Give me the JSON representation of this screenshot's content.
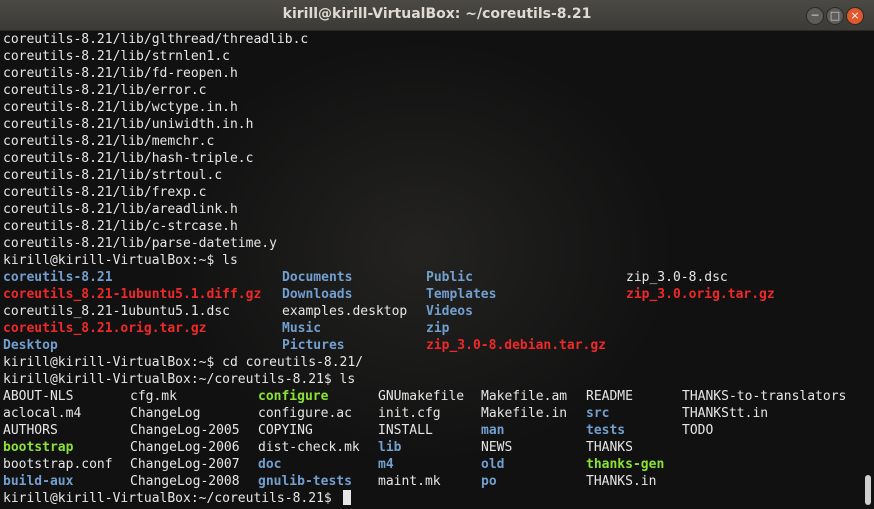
{
  "window": {
    "title": "kirill@kirill-VirtualBox: ~/coreutils-8.21",
    "buttons": {
      "minimize": "─",
      "maximize": "□",
      "close": "×"
    }
  },
  "colors": {
    "dir": "#729fcf",
    "archive": "#ef2929",
    "exec": "#8ae234",
    "text": "#e6e6e6"
  },
  "terminal": {
    "path_lines": [
      "coreutils-8.21/lib/glthread/threadlib.c",
      "coreutils-8.21/lib/strnlen1.c",
      "coreutils-8.21/lib/fd-reopen.h",
      "coreutils-8.21/lib/error.c",
      "coreutils-8.21/lib/wctype.in.h",
      "coreutils-8.21/lib/uniwidth.in.h",
      "coreutils-8.21/lib/memchr.c",
      "coreutils-8.21/lib/hash-triple.c",
      "coreutils-8.21/lib/strtoul.c",
      "coreutils-8.21/lib/frexp.c",
      "coreutils-8.21/lib/areadlink.h",
      "coreutils-8.21/lib/c-strcase.h",
      "coreutils-8.21/lib/parse-datetime.y"
    ],
    "prompt1": "kirill@kirill-VirtualBox:~$ ls",
    "ls1": [
      [
        {
          "t": "coreutils-8.21",
          "k": "dir"
        },
        {
          "t": "Documents",
          "k": "dir"
        },
        {
          "t": "Public",
          "k": "dir"
        },
        {
          "t": "zip_3.0-8.dsc",
          "k": "plain"
        }
      ],
      [
        {
          "t": "coreutils_8.21-1ubuntu5.1.diff.gz",
          "k": "arc"
        },
        {
          "t": "Downloads",
          "k": "dir"
        },
        {
          "t": "Templates",
          "k": "dir"
        },
        {
          "t": "zip_3.0.orig.tar.gz",
          "k": "arc"
        }
      ],
      [
        {
          "t": "coreutils_8.21-1ubuntu5.1.dsc",
          "k": "plain"
        },
        {
          "t": "examples.desktop",
          "k": "plain"
        },
        {
          "t": "Videos",
          "k": "dir"
        },
        {
          "t": "",
          "k": "plain"
        }
      ],
      [
        {
          "t": "coreutils_8.21.orig.tar.gz",
          "k": "arc"
        },
        {
          "t": "Music",
          "k": "dir"
        },
        {
          "t": "zip",
          "k": "dir"
        },
        {
          "t": "",
          "k": "plain"
        }
      ],
      [
        {
          "t": "Desktop",
          "k": "dir"
        },
        {
          "t": "Pictures",
          "k": "dir"
        },
        {
          "t": "zip_3.0-8.debian.tar.gz",
          "k": "arc"
        },
        {
          "t": "",
          "k": "plain"
        }
      ]
    ],
    "prompt2": "kirill@kirill-VirtualBox:~$ cd coreutils-8.21/",
    "prompt3": "kirill@kirill-VirtualBox:~/coreutils-8.21$ ls",
    "ls2": [
      [
        {
          "t": "ABOUT-NLS",
          "k": "plain"
        },
        {
          "t": "cfg.mk",
          "k": "plain"
        },
        {
          "t": "configure",
          "k": "exe"
        },
        {
          "t": "GNUmakefile",
          "k": "plain"
        },
        {
          "t": "Makefile.am",
          "k": "plain"
        },
        {
          "t": "README",
          "k": "plain"
        },
        {
          "t": "THANKS-to-translators",
          "k": "plain"
        }
      ],
      [
        {
          "t": "aclocal.m4",
          "k": "plain"
        },
        {
          "t": "ChangeLog",
          "k": "plain"
        },
        {
          "t": "configure.ac",
          "k": "plain"
        },
        {
          "t": "init.cfg",
          "k": "plain"
        },
        {
          "t": "Makefile.in",
          "k": "plain"
        },
        {
          "t": "src",
          "k": "dir"
        },
        {
          "t": "THANKStt.in",
          "k": "plain"
        }
      ],
      [
        {
          "t": "AUTHORS",
          "k": "plain"
        },
        {
          "t": "ChangeLog-2005",
          "k": "plain"
        },
        {
          "t": "COPYING",
          "k": "plain"
        },
        {
          "t": "INSTALL",
          "k": "plain"
        },
        {
          "t": "man",
          "k": "dir"
        },
        {
          "t": "tests",
          "k": "dir"
        },
        {
          "t": "TODO",
          "k": "plain"
        }
      ],
      [
        {
          "t": "bootstrap",
          "k": "exe"
        },
        {
          "t": "ChangeLog-2006",
          "k": "plain"
        },
        {
          "t": "dist-check.mk",
          "k": "plain"
        },
        {
          "t": "lib",
          "k": "dir"
        },
        {
          "t": "NEWS",
          "k": "plain"
        },
        {
          "t": "THANKS",
          "k": "plain"
        },
        {
          "t": "",
          "k": "plain"
        }
      ],
      [
        {
          "t": "bootstrap.conf",
          "k": "plain"
        },
        {
          "t": "ChangeLog-2007",
          "k": "plain"
        },
        {
          "t": "doc",
          "k": "dir"
        },
        {
          "t": "m4",
          "k": "dir"
        },
        {
          "t": "old",
          "k": "dir"
        },
        {
          "t": "thanks-gen",
          "k": "exe"
        },
        {
          "t": "",
          "k": "plain"
        }
      ],
      [
        {
          "t": "build-aux",
          "k": "dir"
        },
        {
          "t": "ChangeLog-2008",
          "k": "plain"
        },
        {
          "t": "gnulib-tests",
          "k": "dir"
        },
        {
          "t": "maint.mk",
          "k": "plain"
        },
        {
          "t": "po",
          "k": "dir"
        },
        {
          "t": "THANKS.in",
          "k": "plain"
        },
        {
          "t": "",
          "k": "plain"
        }
      ]
    ],
    "prompt4": "kirill@kirill-VirtualBox:~/coreutils-8.21$ "
  }
}
